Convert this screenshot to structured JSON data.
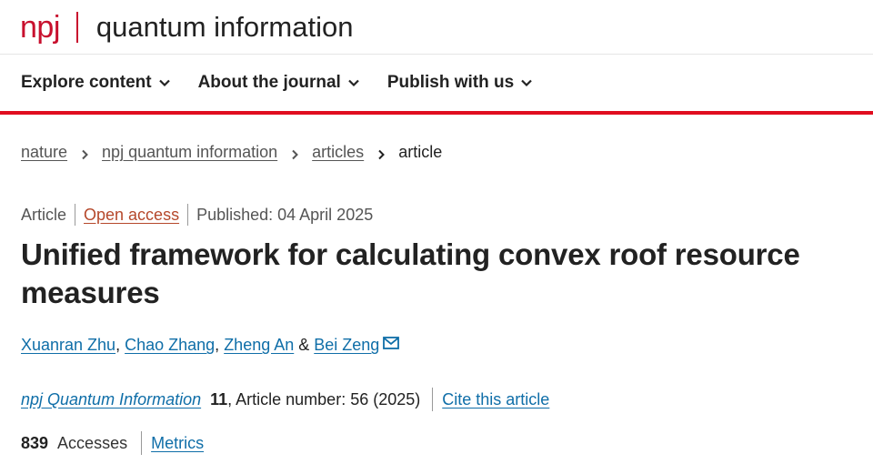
{
  "brand": {
    "short": "npj",
    "name": "quantum information",
    "accent_color": "#c8102e"
  },
  "nav": {
    "items": [
      {
        "label": "Explore content",
        "icon": "chevron-down-icon"
      },
      {
        "label": "About the journal",
        "icon": "chevron-down-icon"
      },
      {
        "label": "Publish with us",
        "icon": "chevron-down-icon"
      }
    ],
    "rule_color": "#e00d1f"
  },
  "breadcrumb": {
    "items": [
      "nature",
      "npj quantum information",
      "articles"
    ],
    "current": "article",
    "separator_icon": "chevron-right-icon"
  },
  "article": {
    "type": "Article",
    "access": "Open access",
    "published": "Published: 04 April 2025",
    "title": "Unified framework for calculating convex roof resource measures",
    "authors": [
      "Xuanran Zhu",
      "Chao Zhang",
      "Zheng An",
      "Bei Zeng"
    ],
    "author_separator": ", ",
    "author_and": " & ",
    "corresponding_icon": "mail-icon",
    "journal": "npj Quantum Information",
    "volume": "11",
    "article_number": ", Article number: 56 (2025)",
    "cite_label": "Cite this article",
    "accesses_count": "839",
    "accesses_label": "Accesses",
    "metrics_label": "Metrics",
    "link_color": "#0f6ea8"
  }
}
